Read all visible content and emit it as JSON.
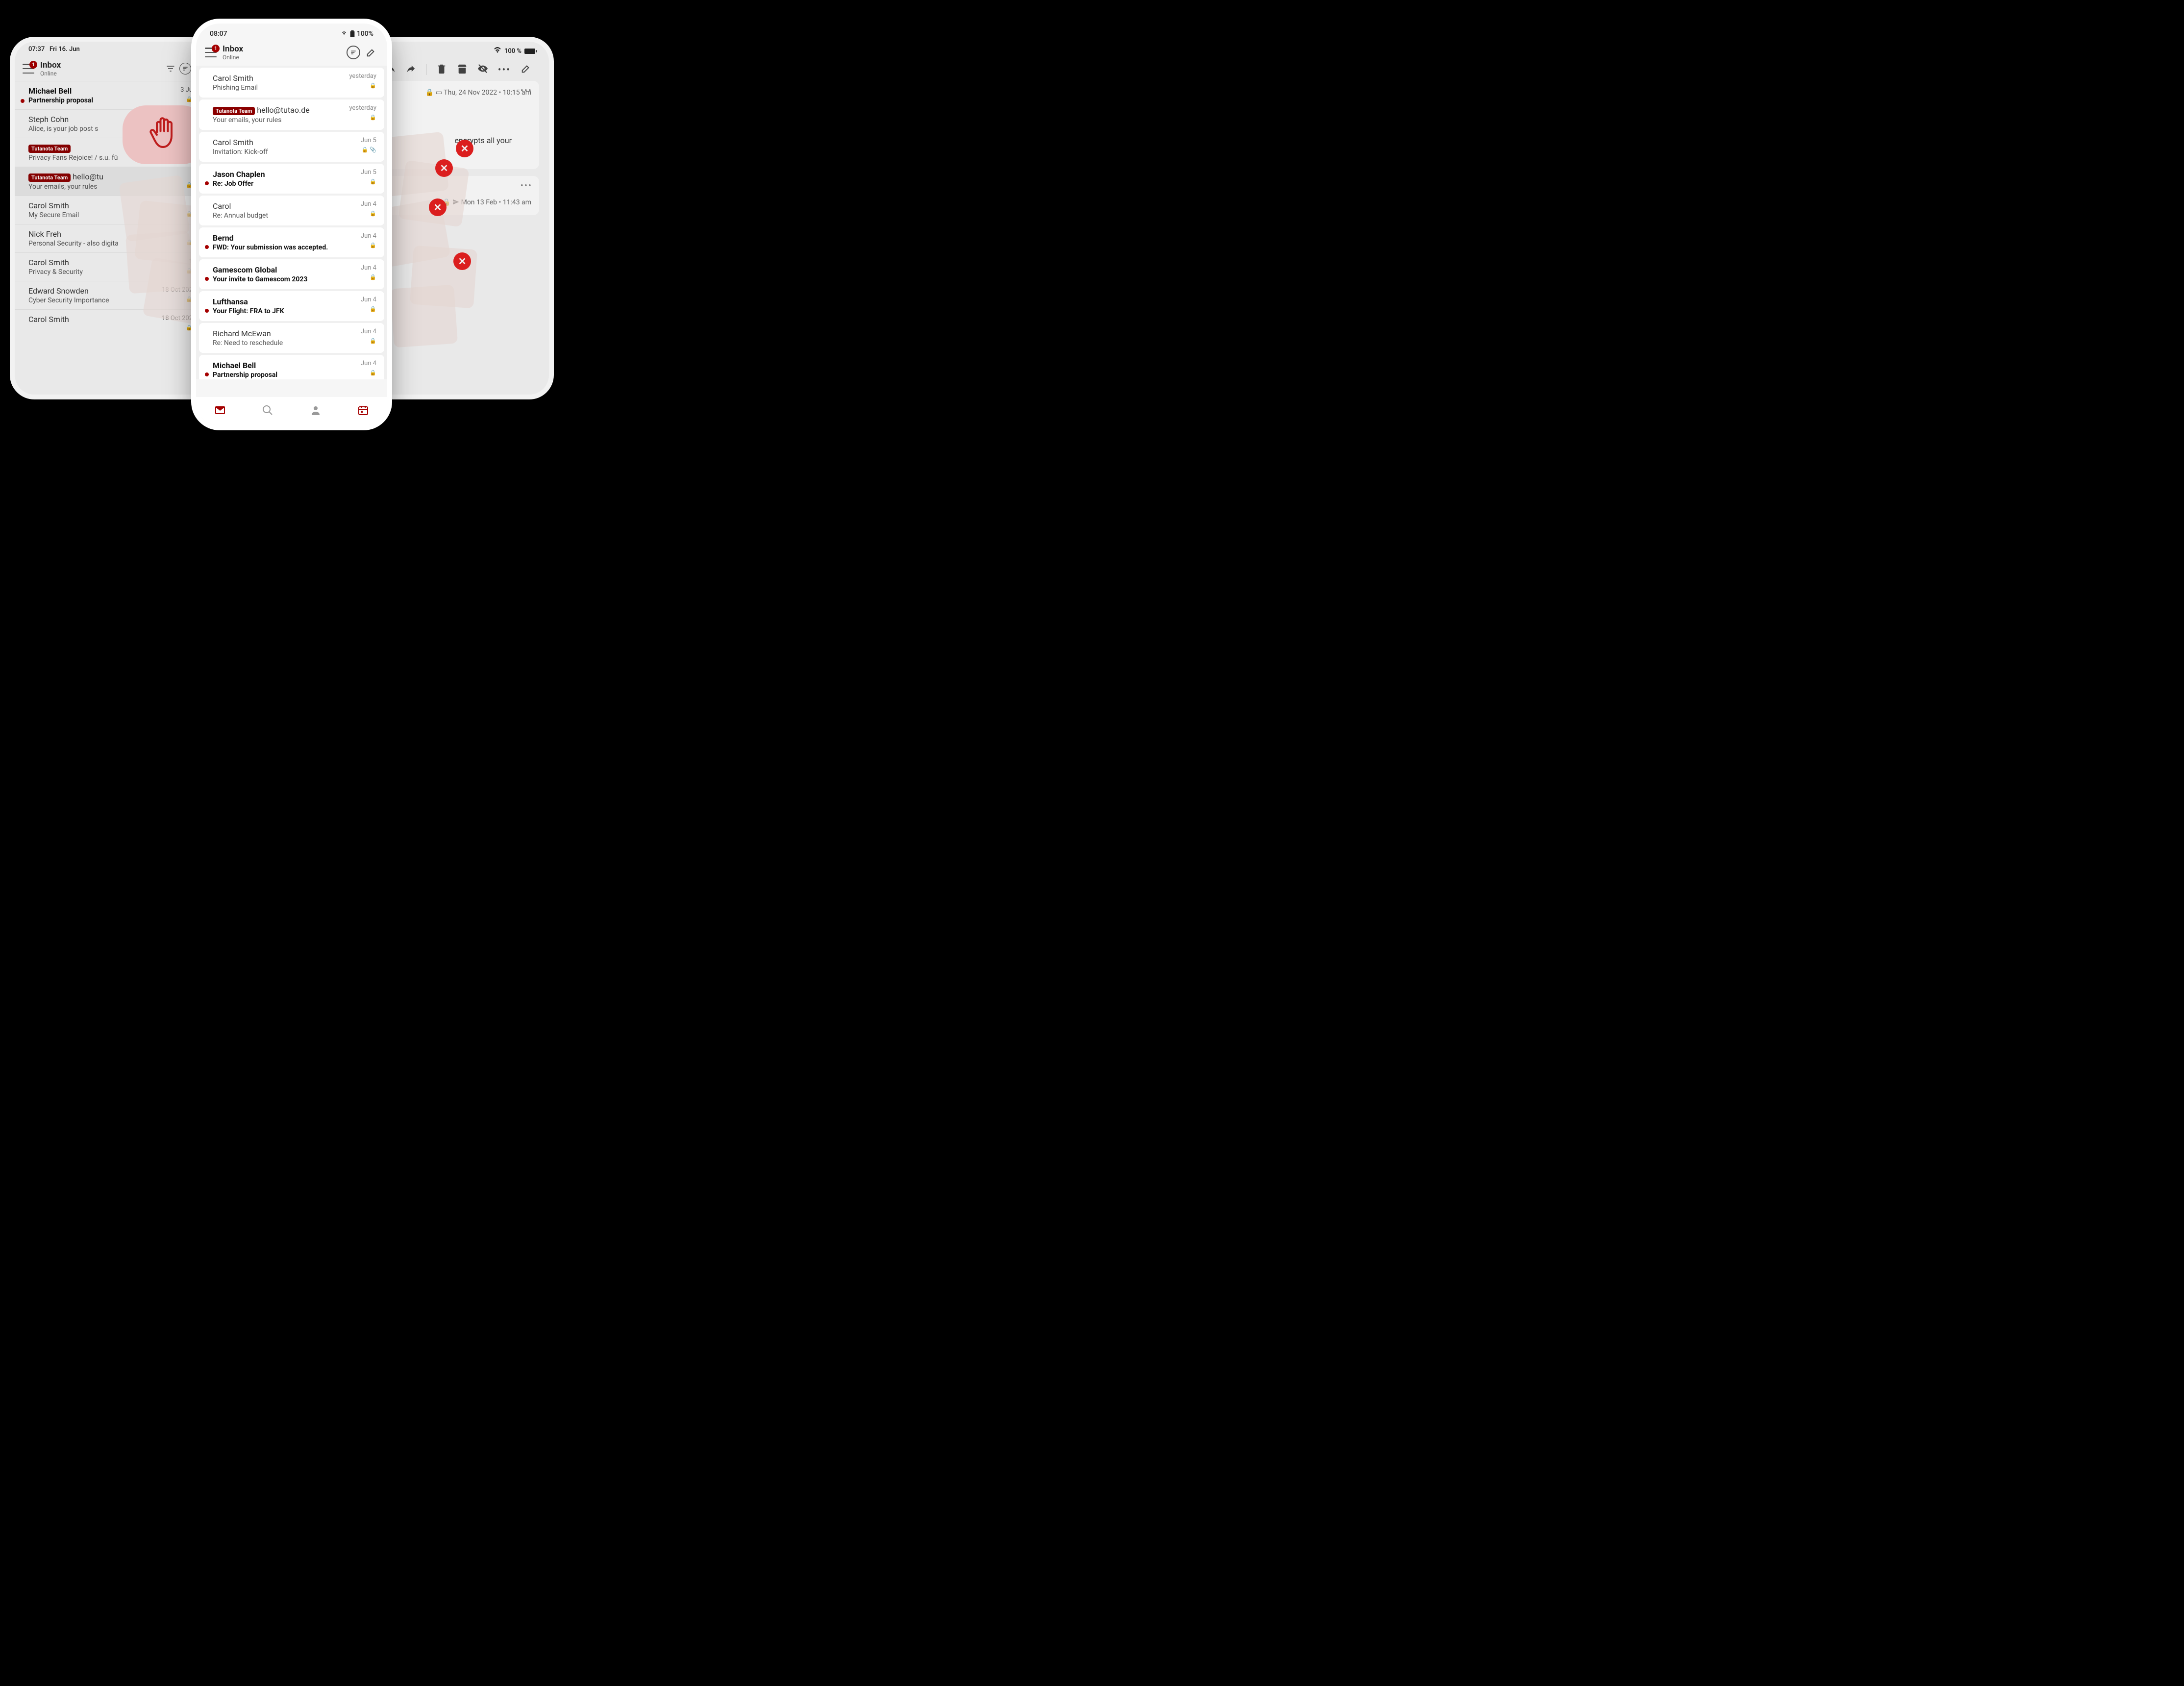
{
  "tablet": {
    "status": {
      "time": "07:37",
      "date": "Fri 16. Jun",
      "battery": "100 %"
    },
    "inbox": {
      "title": "Inbox",
      "status": "Online",
      "badge": "1"
    },
    "emails": [
      {
        "sender": "Michael Bell",
        "subject": "Partnership proposal",
        "date": "3 Ju",
        "unread": true
      },
      {
        "sender": "Steph Cohn",
        "subject": "Alice, is your job post s",
        "date": "",
        "unread": false
      },
      {
        "badge": "Tutanota Team",
        "sender": "",
        "subject": "Privacy Fans Rejoice! / s.u. fü",
        "date": "",
        "unread": false
      },
      {
        "badge": "Tutanota Team",
        "sender": "hello@tu",
        "subject": "Your emails, your rules",
        "date": "",
        "unread": false,
        "selected": true
      },
      {
        "sender": "Carol Smith",
        "subject": "My Secure Email",
        "date": "",
        "unread": false
      },
      {
        "sender": "Nick Freh",
        "subject": "Personal Security - also digita",
        "date": "",
        "unread": false
      },
      {
        "sender": "Carol Smith",
        "subject": "Privacy & Security",
        "date": "1",
        "unread": false
      },
      {
        "sender": "Edward Snowden",
        "subject": "Cyber Security Importance",
        "date": "18 Oct 202",
        "unread": false
      },
      {
        "sender": "Carol Smith",
        "subject": "",
        "date": "18 Oct 202",
        "unread": false
      }
    ],
    "message1": {
      "date": "Thu, 24 Nov 2022 • 10:15 am",
      "body_fragment": "encrypts all your"
    },
    "message2": {
      "date": "Mon 13 Feb • 11:43 am"
    }
  },
  "phone": {
    "status": {
      "time": "08:07",
      "battery": "100%"
    },
    "inbox": {
      "title": "Inbox",
      "status": "Online",
      "badge": "1"
    },
    "emails": [
      {
        "sender": "Carol Smith",
        "subject": "Phishing Email",
        "date": "yesterday",
        "unread": false
      },
      {
        "badge": "Tutanota Team",
        "sender": "hello@tutao.de",
        "subject": "Your emails, your rules",
        "date": "yesterday",
        "unread": false
      },
      {
        "sender": "Carol Smith",
        "subject": "Invitation: Kick-off",
        "date": "Jun 5",
        "unread": false,
        "attachment": true
      },
      {
        "sender": "Jason Chaplen",
        "subject": "Re: Job Offer",
        "date": "Jun 5",
        "unread": true
      },
      {
        "sender": "Carol",
        "subject": "Re: Annual budget",
        "date": "Jun 4",
        "unread": false
      },
      {
        "sender": "Bernd",
        "subject": "FWD: Your submission was accepted.",
        "date": "Jun 4",
        "unread": true
      },
      {
        "sender": "Gamescom Global",
        "subject": "Your invite to Gamescom 2023",
        "date": "Jun 4",
        "unread": true
      },
      {
        "sender": "Lufthansa",
        "subject": "Your Flight: FRA to JFK",
        "date": "Jun 4",
        "unread": true
      },
      {
        "sender": "Richard McEwan",
        "subject": "Re: Need to reschedule",
        "date": "Jun 4",
        "unread": false
      },
      {
        "sender": "Michael Bell",
        "subject": "Partnership proposal",
        "date": "Jun 4",
        "unread": true
      }
    ]
  },
  "labels": {
    "team_badge": "Tutanota Team"
  }
}
